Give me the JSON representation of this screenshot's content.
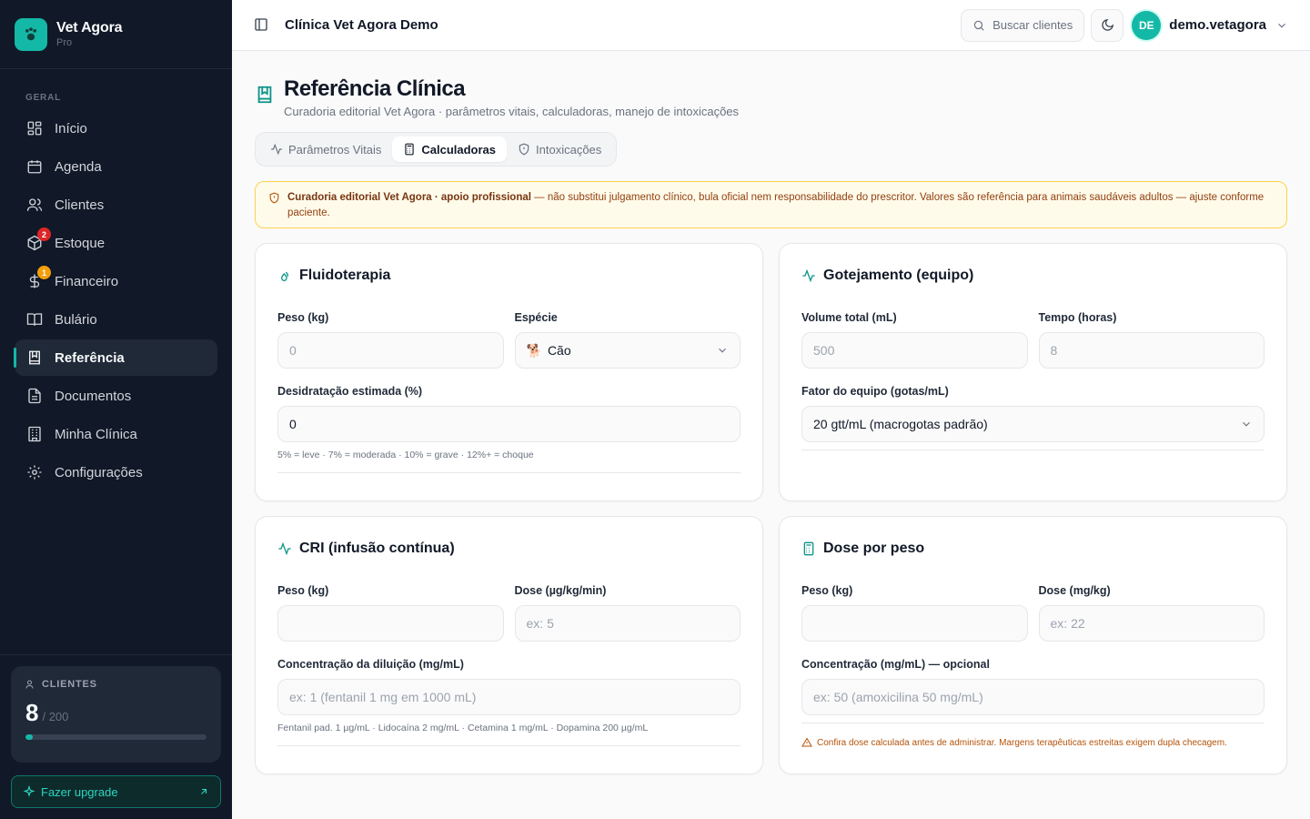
{
  "brand": {
    "name": "Vet Agora",
    "plan": "Pro"
  },
  "sidebar": {
    "section_label": "GERAL",
    "items": [
      {
        "label": "Início",
        "icon": "grid-icon"
      },
      {
        "label": "Agenda",
        "icon": "calendar-icon"
      },
      {
        "label": "Clientes",
        "icon": "users-icon"
      },
      {
        "label": "Estoque",
        "icon": "package-icon",
        "badge": "2"
      },
      {
        "label": "Financeiro",
        "icon": "dollar-icon",
        "badge": "1"
      },
      {
        "label": "Bulário",
        "icon": "book-open-icon"
      },
      {
        "label": "Referência",
        "icon": "bookmark-book-icon",
        "active": true
      },
      {
        "label": "Documentos",
        "icon": "file-icon"
      },
      {
        "label": "Minha Clínica",
        "icon": "building-icon"
      },
      {
        "label": "Configurações",
        "icon": "gear-icon"
      }
    ],
    "clients_card": {
      "title": "CLIENTES",
      "count": "8",
      "limit": "/ 200",
      "usage_fraction": 0.04
    },
    "upgrade_label": "Fazer upgrade"
  },
  "topbar": {
    "clinic_name": "Clínica Vet Agora Demo",
    "search_label": "Buscar clientes",
    "avatar_initials": "DE",
    "username": "demo.vetagora"
  },
  "page": {
    "title": "Referência Clínica",
    "subtitle": "Curadoria editorial Vet Agora · parâmetros vitais, calculadoras, manejo de intoxicações",
    "tabs": [
      {
        "label": "Parâmetros Vitais",
        "icon": "activity-icon"
      },
      {
        "label": "Calculadoras",
        "icon": "calculator-icon",
        "active": true
      },
      {
        "label": "Intoxicações",
        "icon": "shield-icon"
      }
    ],
    "alert": {
      "bold": "Curadoria editorial Vet Agora · apoio profissional",
      "text": " — não substitui julgamento clínico, bula oficial nem responsabilidade do prescritor. Valores são referência para animais saudáveis adultos — ajuste conforme paciente."
    }
  },
  "cards": {
    "fluido": {
      "title": "Fluidoterapia",
      "peso_label": "Peso (kg)",
      "peso_value": "0",
      "especie_label": "Espécie",
      "especie_value": "Cão",
      "especie_icon": "🐕",
      "desid_label": "Desidratação estimada (%)",
      "desid_value": "0",
      "hint": "5% = leve · 7% = moderada · 10% = grave · 12%+ = choque"
    },
    "gotej": {
      "title": "Gotejamento (equipo)",
      "volume_label": "Volume total (mL)",
      "volume_value": "500",
      "tempo_label": "Tempo (horas)",
      "tempo_value": "8",
      "fator_label": "Fator do equipo (gotas/mL)",
      "fator_value": "20 gtt/mL (macrogotas padrão)"
    },
    "cri": {
      "title": "CRI (infusão contínua)",
      "peso_label": "Peso (kg)",
      "peso_value": "",
      "dose_label": "Dose (µg/kg/min)",
      "dose_placeholder": "ex: 5",
      "conc_label": "Concentração da diluição (mg/mL)",
      "conc_placeholder": "ex: 1 (fentanil 1 mg em 1000 mL)",
      "hint": "Fentanil pad. 1 µg/mL · Lidocaína 2 mg/mL · Cetamina 1 mg/mL · Dopamina 200 µg/mL"
    },
    "dose": {
      "title": "Dose por peso",
      "peso_label": "Peso (kg)",
      "peso_value": "",
      "dose_label": "Dose (mg/kg)",
      "dose_placeholder": "ex: 22",
      "conc_label": "Concentração (mg/mL) — opcional",
      "conc_placeholder": "ex: 50 (amoxicilina 50 mg/mL)",
      "warning": "Confira dose calculada antes de administrar. Margens terapêuticas estreitas exigem dupla checagem."
    }
  },
  "colors": {
    "accent": "#14b8a6",
    "sidebar_bg": "#111827",
    "warning": "#b45309",
    "badge_red": "#dc2626",
    "badge_amber": "#f59e0b"
  }
}
